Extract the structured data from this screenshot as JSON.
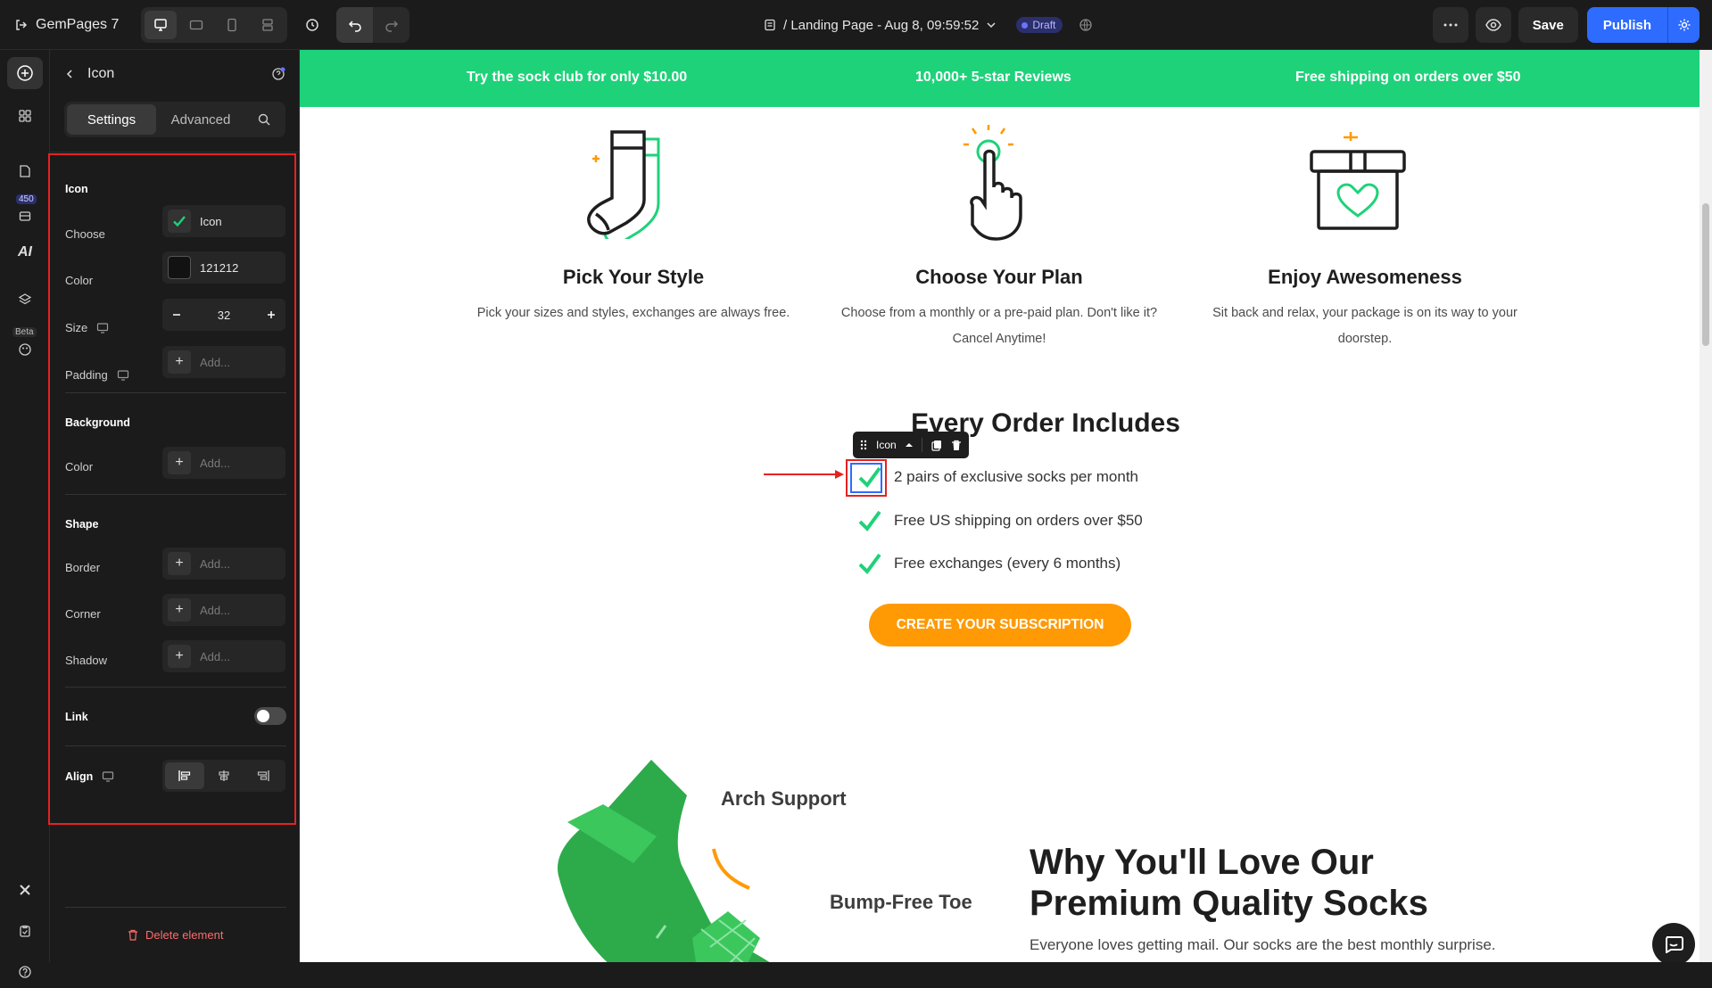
{
  "app": {
    "name": "GemPages 7",
    "page_title": "/ Landing Page - Aug 8, 09:59:52",
    "status_badge": "Draft",
    "save_label": "Save",
    "publish_label": "Publish"
  },
  "rail": {
    "badge_count": "450",
    "ai_label": "AI",
    "beta_label": "Beta"
  },
  "panel": {
    "title": "Icon",
    "tabs": [
      "Settings",
      "Advanced"
    ],
    "active_tab": "Settings",
    "icon_section": {
      "title": "Icon",
      "choose_label": "Choose",
      "choose_value": "Icon",
      "color_label": "Color",
      "color_value": "121212",
      "size_label": "Size",
      "size_value": "32",
      "padding_label": "Padding",
      "padding_placeholder": "Add..."
    },
    "background_section": {
      "title": "Background",
      "color_label": "Color",
      "color_placeholder": "Add..."
    },
    "shape_section": {
      "title": "Shape",
      "border_label": "Border",
      "corner_label": "Corner",
      "shadow_label": "Shadow",
      "placeholder": "Add..."
    },
    "link_label": "Link",
    "link_enabled": false,
    "align_label": "Align",
    "align_selected": "left",
    "delete_label": "Delete element"
  },
  "canvas": {
    "promo": [
      "Try the sock club for only $10.00",
      "10,000+ 5-star Reviews",
      "Free shipping on orders over $50"
    ],
    "steps": [
      {
        "icon": "socks-icon",
        "title": "Pick Your Style",
        "desc": "Pick your sizes and styles, exchanges are always free."
      },
      {
        "icon": "tap-hand-icon",
        "title": "Choose Your Plan",
        "desc": "Choose from a monthly or a pre-paid plan. Don't like it? Cancel Anytime!"
      },
      {
        "icon": "gift-box-icon",
        "title": "Enjoy Awesomeness",
        "desc": "Sit back and relax, your package is on its way to your doorstep."
      }
    ],
    "includes_title": "Every Order Includes",
    "element_toolbar_label": "Icon",
    "includes": [
      "2 pairs of exclusive socks per month",
      "Free US shipping on orders over $50",
      "Free exchanges (every 6 months)"
    ],
    "cta_label": "CREATE YOUR SUBSCRIPTION",
    "sock_labels": [
      "Arch Support",
      "Bump-Free Toe"
    ],
    "why_title_line1": "Why You'll Love Our",
    "why_title_line2": "Premium Quality Socks",
    "why_desc": "Everyone loves getting mail. Our socks are the best monthly surprise."
  },
  "colors": {
    "accent_green": "#1ed27a",
    "cta_orange": "#ff9a05",
    "publish_blue": "#2e6bff",
    "selection_red": "#e52222",
    "icon_color": "#121212"
  }
}
